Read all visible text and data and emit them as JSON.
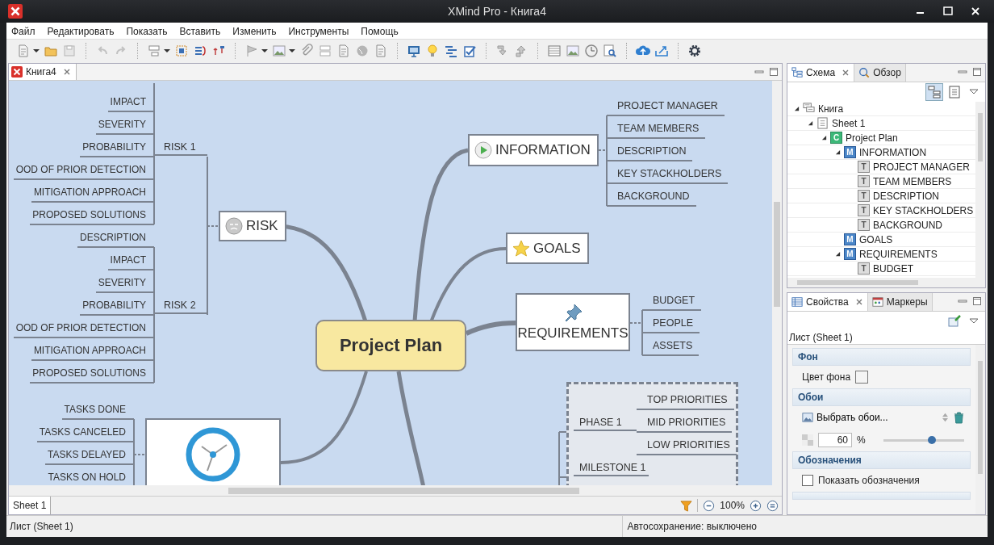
{
  "window": {
    "title": "XMind Pro - Книга4"
  },
  "menu": [
    "Файл",
    "Редактировать",
    "Показать",
    "Вставить",
    "Изменить",
    "Инструменты",
    "Помощь"
  ],
  "editor": {
    "tabs": [
      {
        "label": "Книга4",
        "selected": true
      }
    ],
    "mindmap": {
      "central": {
        "label": "Project Plan"
      },
      "branches": [
        {
          "kind": "risk",
          "label": "RISK",
          "children": [
            {
              "label": "RISK 1",
              "children": [
                {
                  "label": "IMPACT"
                },
                {
                  "label": "SEVERITY"
                },
                {
                  "label": "PROBABILITY"
                },
                {
                  "label": "OOD OF PRIOR DETECTION"
                },
                {
                  "label": "MITIGATION APPROACH"
                },
                {
                  "label": "PROPOSED SOLUTIONS"
                }
              ]
            },
            {
              "label": "RISK 2",
              "children": [
                {
                  "label": "DESCRIPTION"
                },
                {
                  "label": "IMPACT"
                },
                {
                  "label": "SEVERITY"
                },
                {
                  "label": "PROBABILITY"
                },
                {
                  "label": "OOD OF PRIOR DETECTION"
                },
                {
                  "label": "MITIGATION APPROACH"
                },
                {
                  "label": "PROPOSED SOLUTIONS"
                }
              ]
            }
          ]
        },
        {
          "kind": "info",
          "label": "INFORMATION",
          "children": [
            {
              "label": "PROJECT MANAGER"
            },
            {
              "label": "TEAM MEMBERS"
            },
            {
              "label": "DESCRIPTION"
            },
            {
              "label": "KEY STACKHOLDERS"
            },
            {
              "label": "BACKGROUND"
            }
          ]
        },
        {
          "kind": "goals",
          "label": "GOALS"
        },
        {
          "kind": "requirements",
          "label": "REQUIREMENTS",
          "children": [
            {
              "label": "BUDGET"
            },
            {
              "label": "PEOPLE"
            },
            {
              "label": "ASSETS"
            }
          ]
        },
        {
          "kind": "clock",
          "children": [
            {
              "label": "TASKS DONE"
            },
            {
              "label": "TASKS CANCELED"
            },
            {
              "label": "TASKS DELAYED"
            },
            {
              "label": "TASKS ON HOLD"
            }
          ]
        },
        {
          "kind": "phase",
          "children": [
            {
              "label": "PHASE 1",
              "children": [
                {
                  "label": "TOP PRIORITIES"
                },
                {
                  "label": "MID PRIORITIES"
                },
                {
                  "label": "LOW PRIORITIES"
                }
              ]
            },
            {
              "label": "MILESTONE 1"
            }
          ]
        }
      ]
    },
    "sheet_tabs": [
      {
        "label": "Sheet 1",
        "selected": true
      }
    ],
    "zoom": "100%"
  },
  "outline": {
    "tabs": [
      {
        "label": "Схема",
        "selected": true
      },
      {
        "label": "Обзор",
        "selected": false
      }
    ],
    "tree": [
      {
        "label": "Книга",
        "kind": "workbook",
        "expanded": true,
        "children": [
          {
            "label": "Sheet 1",
            "kind": "sheet",
            "expanded": true,
            "children": [
              {
                "label": "Project Plan",
                "kind": "central",
                "badge": "C",
                "expanded": true,
                "children": [
                  {
                    "label": "INFORMATION",
                    "kind": "main",
                    "badge": "M",
                    "expanded": true,
                    "children": [
                      {
                        "label": "PROJECT MANAGER",
                        "kind": "topic",
                        "badge": "T"
                      },
                      {
                        "label": "TEAM MEMBERS",
                        "kind": "topic",
                        "badge": "T"
                      },
                      {
                        "label": "DESCRIPTION",
                        "kind": "topic",
                        "badge": "T"
                      },
                      {
                        "label": "KEY STACKHOLDERS",
                        "kind": "topic",
                        "badge": "T"
                      },
                      {
                        "label": "BACKGROUND",
                        "kind": "topic",
                        "badge": "T"
                      }
                    ]
                  },
                  {
                    "label": "GOALS",
                    "kind": "main",
                    "badge": "M"
                  },
                  {
                    "label": "REQUIREMENTS",
                    "kind": "main",
                    "badge": "M",
                    "expanded": true,
                    "children": [
                      {
                        "label": "BUDGET",
                        "kind": "topic",
                        "badge": "T"
                      }
                    ]
                  }
                ]
              }
            ]
          }
        ]
      }
    ]
  },
  "properties": {
    "tabs": [
      {
        "label": "Свойства",
        "selected": true
      },
      {
        "label": "Маркеры",
        "selected": false
      }
    ],
    "subject": "Лист (Sheet 1)",
    "sections": [
      {
        "title": "Фон",
        "kind": "color",
        "label": "Цвет фона"
      },
      {
        "title": "Обои",
        "kind": "wallpaper",
        "button": "Выбрать обои...",
        "opacity": "60",
        "unit": "%",
        "level": 0.6
      },
      {
        "title": "Обозначения",
        "kind": "checkbox",
        "label": "Показать обозначения",
        "checked": false
      }
    ]
  },
  "status_bar": {
    "left": "Лист (Sheet 1)",
    "right": "Автосохранение: выключено"
  }
}
